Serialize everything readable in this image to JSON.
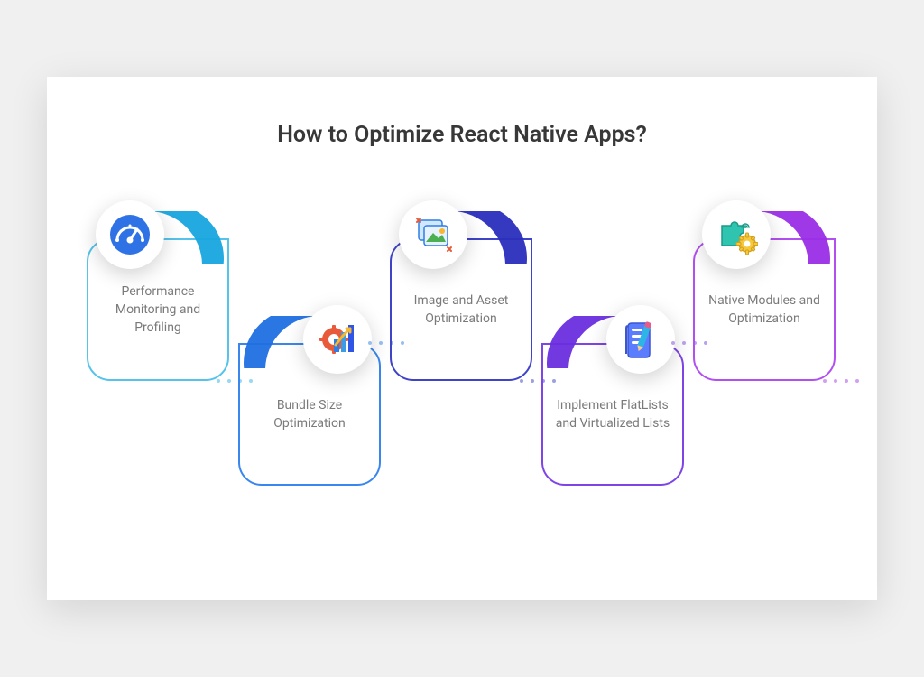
{
  "title": "How to Optimize React Native Apps?",
  "cards": [
    {
      "label": "Performance Monitoring and Profiling",
      "icon": "gauge-icon",
      "color": "#2fb4e6"
    },
    {
      "label": "Bundle Size Optimization",
      "icon": "gear-chart-icon",
      "color": "#2f7de6"
    },
    {
      "label": "Image and Asset Optimization",
      "icon": "images-icon",
      "color": "#3c3fbf"
    },
    {
      "label": "Implement FlatLists and Virtualized Lists",
      "icon": "checklist-icon",
      "color": "#7a3fe0"
    },
    {
      "label": "Native Modules and Optimization",
      "icon": "puzzle-gear-icon",
      "color": "#a63fe6"
    }
  ]
}
